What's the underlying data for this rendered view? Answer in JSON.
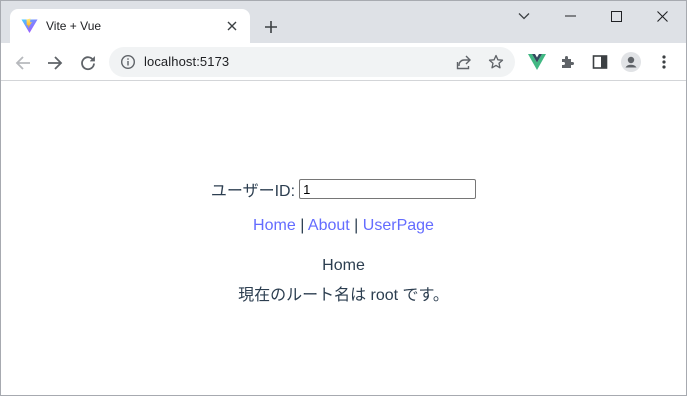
{
  "browser": {
    "tab": {
      "title": "Vite + Vue",
      "favicon": "vite-logo-icon"
    },
    "address_bar": {
      "url": "localhost:5173"
    },
    "window_controls": [
      "chevron-down-icon",
      "minimize-icon",
      "maximize-icon",
      "close-icon"
    ],
    "toolbar_icons": [
      "back-arrow-icon",
      "forward-arrow-icon",
      "reload-icon",
      "share-icon",
      "bookmark-star-icon",
      "vue-devtools-icon",
      "extensions-puzzle-icon",
      "side-panel-icon",
      "profile-avatar-icon",
      "kebab-menu-icon"
    ]
  },
  "page": {
    "user_id_label": "ユーザーID:",
    "user_id_value": "1",
    "nav": {
      "home": "Home",
      "about": "About",
      "userpage": "UserPage",
      "separator": "|"
    },
    "view_title": "Home",
    "route_message": "現在のルート名は root です。"
  },
  "colors": {
    "link": "#646cff",
    "text": "#2c3e50",
    "tabstrip": "#dee1e6",
    "omnibox": "#f1f3f4"
  }
}
